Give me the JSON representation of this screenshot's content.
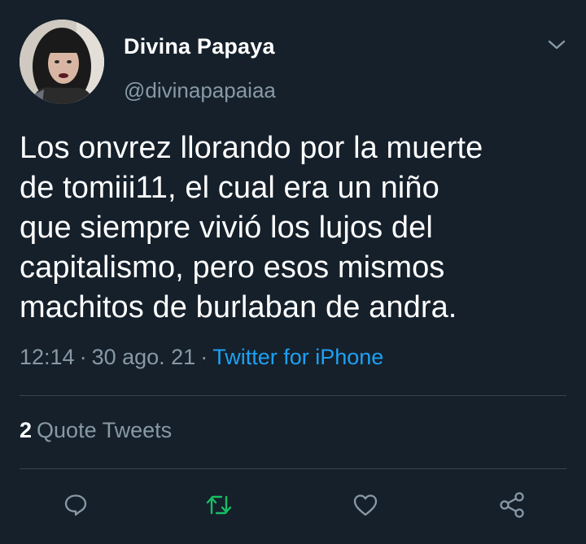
{
  "author": {
    "display_name": "Divina Papaya",
    "handle": "@divinapapaiaa"
  },
  "tweet": {
    "text": "Los onvrez llorando por la muerte\nde tomiii11, el cual era un niño\nque siempre vivió los lujos del\ncapitalismo, pero esos mismos\nmachitos de burlaban de andra.",
    "time": "12:14",
    "date": "30 ago. 21",
    "separator": "·",
    "source": "Twitter for iPhone"
  },
  "stats": {
    "quote_count": "2",
    "quote_label": "Quote Tweets"
  },
  "actions": [
    {
      "name": "reply",
      "icon": "reply-icon"
    },
    {
      "name": "retweet",
      "icon": "retweet-icon",
      "color": "#17bf63"
    },
    {
      "name": "like",
      "icon": "heart-icon"
    },
    {
      "name": "share",
      "icon": "share-icon"
    }
  ],
  "colors": {
    "background": "#15202b",
    "primary_text": "#ffffff",
    "secondary_text": "#8899a6",
    "link": "#1da1f2",
    "retweet_green": "#17bf63",
    "divider": "#38444d"
  }
}
